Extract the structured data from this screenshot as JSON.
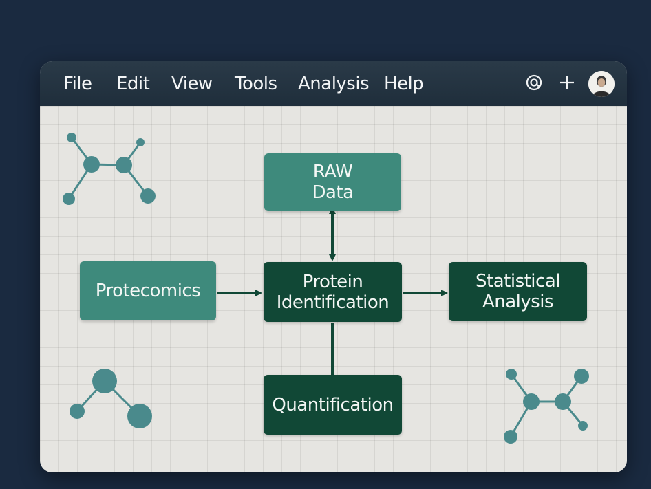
{
  "menu": {
    "file": "File",
    "edit": "Edit",
    "view": "View",
    "tools": "Tools",
    "analysis": "Analysis",
    "help": "Help"
  },
  "toolbar": {
    "icons": [
      "at-icon",
      "plus-icon",
      "avatar"
    ]
  },
  "diagram": {
    "raw_data_line1": "RAW",
    "raw_data_line2": "Data",
    "protecomics": "Protecomics",
    "protein_id_line1": "Protein",
    "protein_id_line2": "Identification",
    "statistical_line1": "Statistical",
    "statistical_line2": "Analysis",
    "quantification": "Quantification"
  },
  "colors": {
    "background": "#1a2a40",
    "menubar": "#23323f",
    "canvas": "#e6e5e1",
    "node_light": "#3e8a7c",
    "node_dark": "#114836",
    "arrow": "#114836",
    "molecule": "#4a8a8c"
  }
}
